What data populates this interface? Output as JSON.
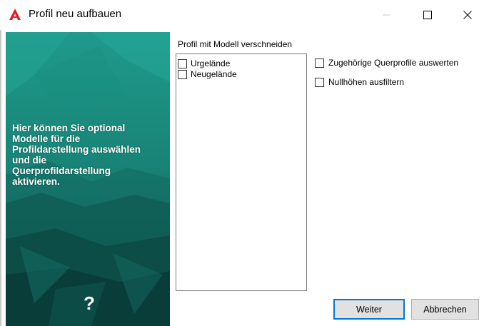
{
  "window": {
    "title": "Profil neu aufbauen",
    "app_icon": "autocad-logo-icon",
    "controls": [
      "minimize-icon",
      "maximize-icon",
      "close-icon"
    ]
  },
  "sidepanel": {
    "text_lines": [
      "Hier können Sie optional",
      "Modelle für die",
      "Profildarstellung auswählen",
      "und die",
      "Querprofildarstellung",
      "aktivieren."
    ],
    "help_glyph": "?",
    "colors": {
      "teal": "#1b8d7f",
      "dark": "#0d4f49"
    }
  },
  "main": {
    "group_label": "Profil mit Modell verschneiden",
    "models": [
      {
        "label": "Urgelände",
        "checked": false
      },
      {
        "label": "Neugelände",
        "checked": false
      }
    ],
    "options": {
      "cross_profiles": {
        "label": "Zugehörige Querprofile auswerten",
        "checked": false
      },
      "null_heights": {
        "label": "Nullhöhen ausfiltern",
        "checked": false
      }
    }
  },
  "buttons": {
    "next": "Weiter",
    "cancel": "Abbrechen"
  },
  "colors": {
    "accent": "#0078d7"
  }
}
